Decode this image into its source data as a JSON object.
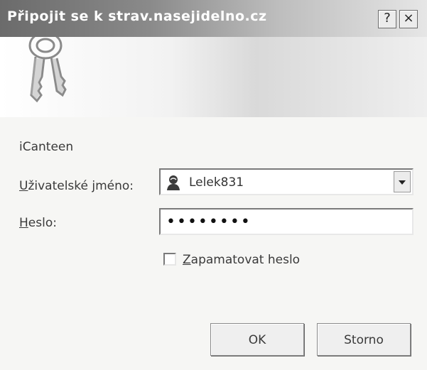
{
  "window": {
    "title": "Připojit se k strav.nasejidelno.cz",
    "help_label": "?",
    "close_label": "×"
  },
  "form": {
    "app_name": "iCanteen",
    "username_label_prefix": "U",
    "username_label_rest": "živatelské jméno:",
    "username_value": "Lelek831",
    "password_label_prefix": "H",
    "password_label_rest": "eslo:",
    "password_mask": "••••••••",
    "remember_label_prefix": "Z",
    "remember_label_rest": "apamatovat heslo",
    "remember_checked": false
  },
  "buttons": {
    "ok_label": "OK",
    "cancel_label": "Storno"
  },
  "icons": {
    "banner": "keys-icon",
    "user": "user-icon",
    "dropdown": "chevron-down-icon"
  }
}
